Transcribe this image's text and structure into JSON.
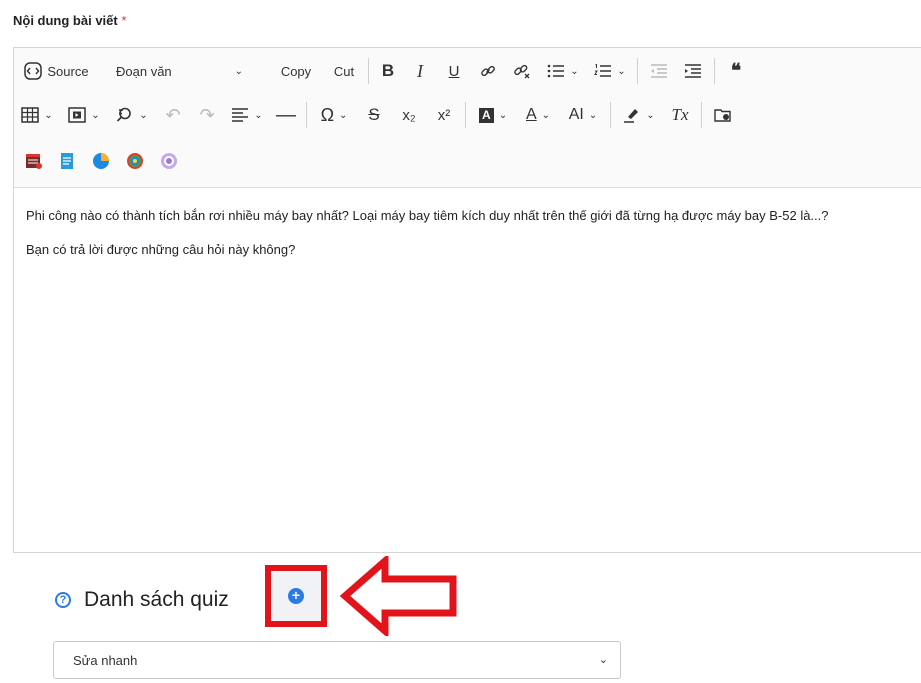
{
  "field": {
    "label": "Nội dung bài viết",
    "required_mark": "*"
  },
  "toolbar": {
    "source_label": "Source",
    "paragraph_label": "Đoạn văn",
    "copy_label": "Copy",
    "cut_label": "Cut",
    "bold": "B",
    "italic": "I",
    "underline": "U",
    "blockquote": "❝",
    "undo": "↶",
    "redo": "↷",
    "hr": "—",
    "omega": "Ω",
    "strike": "S",
    "subscript": "x₂",
    "superscript": "x²",
    "font_color_letter": "A",
    "font_size_label": "AI",
    "clear_format": "Tx"
  },
  "content": {
    "paragraphs": [
      "Phi công nào có thành tích bắn rơi nhiều máy bay nhất? Loại máy bay tiêm kích duy nhất trên thế giới đã từng hạ được máy bay B-52 là...?",
      "Bạn có trả lời được những câu hỏi này không?"
    ]
  },
  "quiz": {
    "help_glyph": "?",
    "title": "Danh sách quiz",
    "add_glyph": "+"
  },
  "select": {
    "value": "Sửa nhanh",
    "chevron": "⌄"
  }
}
